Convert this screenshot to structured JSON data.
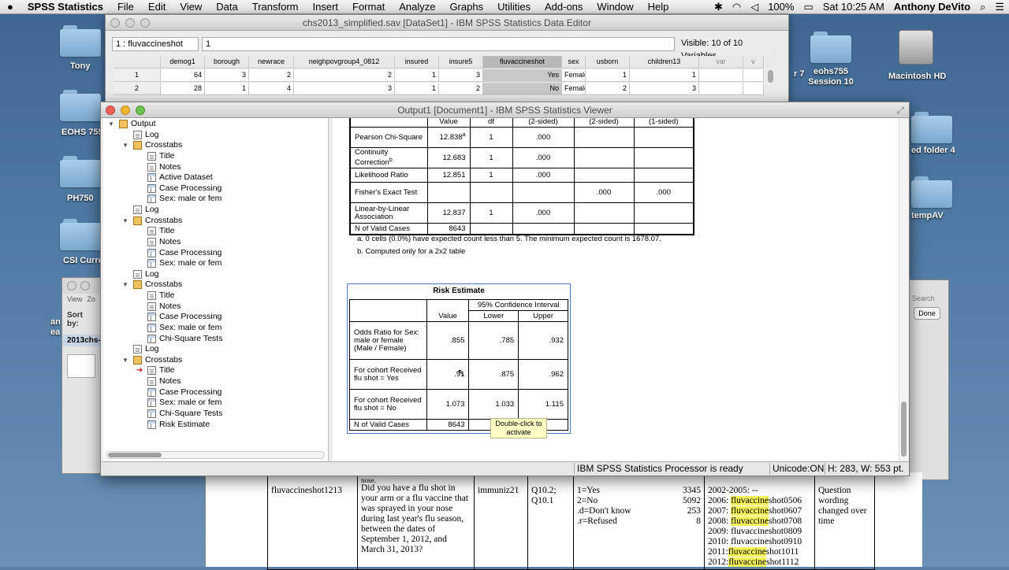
{
  "menubar": {
    "app": "SPSS Statistics",
    "items": [
      "File",
      "Edit",
      "View",
      "Data",
      "Transform",
      "Insert",
      "Format",
      "Analyze",
      "Graphs",
      "Utilities",
      "Add-ons",
      "Window",
      "Help"
    ],
    "battery": "100%",
    "clock": "Sat 10:25 AM",
    "user": "Anthony DeVito"
  },
  "desktop": {
    "left_icons": [
      "Tony",
      "EOHS 755",
      "PH750",
      "CSI Curre"
    ],
    "right_icons": [
      "eohs755 Session 10",
      "Macintosh HD",
      "ed folder 4",
      "tempAV"
    ],
    "partial": "r 7",
    "side_texts": [
      "an",
      "ea"
    ]
  },
  "data_editor": {
    "title": "chs2013_simplified.sav [DataSet1] - IBM SPSS Statistics Data Editor",
    "cell_ref": "1 : fluvaccineshot",
    "cell_value": "1",
    "visible": "Visible: 10 of 10 Variables",
    "columns": [
      "demog1",
      "borough",
      "newrace",
      "neighpovgroup4_0812",
      "insured",
      "insure5",
      "fluvaccineshot",
      "sex",
      "usborn",
      "children13",
      "var",
      "v"
    ],
    "rows": [
      [
        "1",
        "64",
        "3",
        "2",
        "2",
        "1",
        "3",
        "Yes",
        "Female",
        "1",
        "1",
        "",
        ""
      ],
      [
        "2",
        "28",
        "1",
        "4",
        "3",
        "1",
        "2",
        "No",
        "Female",
        "2",
        "3",
        "",
        ""
      ]
    ]
  },
  "viewer": {
    "title": "Output1 [Document1] - IBM SPSS Statistics Viewer",
    "tree": [
      {
        "label": "Output",
        "level": 0,
        "icon": "book",
        "tri": "▼"
      },
      {
        "label": "Log",
        "level": 1,
        "icon": "page"
      },
      {
        "label": "Crosstabs",
        "level": 1,
        "icon": "book",
        "tri": "▼"
      },
      {
        "label": "Title",
        "level": 2,
        "icon": "page"
      },
      {
        "label": "Notes",
        "level": 2,
        "icon": "page"
      },
      {
        "label": "Active Dataset",
        "level": 2,
        "icon": "tbl"
      },
      {
        "label": "Case Processing",
        "level": 2,
        "icon": "tbl"
      },
      {
        "label": "Sex: male or fem",
        "level": 2,
        "icon": "tbl"
      },
      {
        "label": "Log",
        "level": 1,
        "icon": "page"
      },
      {
        "label": "Crosstabs",
        "level": 1,
        "icon": "book",
        "tri": "▼"
      },
      {
        "label": "Title",
        "level": 2,
        "icon": "page"
      },
      {
        "label": "Notes",
        "level": 2,
        "icon": "page"
      },
      {
        "label": "Case Processing",
        "level": 2,
        "icon": "tbl"
      },
      {
        "label": "Sex: male or fem",
        "level": 2,
        "icon": "tbl"
      },
      {
        "label": "Log",
        "level": 1,
        "icon": "page"
      },
      {
        "label": "Crosstabs",
        "level": 1,
        "icon": "book",
        "tri": "▼"
      },
      {
        "label": "Title",
        "level": 2,
        "icon": "page"
      },
      {
        "label": "Notes",
        "level": 2,
        "icon": "page"
      },
      {
        "label": "Case Processing",
        "level": 2,
        "icon": "tbl"
      },
      {
        "label": "Sex: male or fem",
        "level": 2,
        "icon": "tbl"
      },
      {
        "label": "Chi-Square Tests",
        "level": 2,
        "icon": "tbl"
      },
      {
        "label": "Log",
        "level": 1,
        "icon": "page"
      },
      {
        "label": "Crosstabs",
        "level": 1,
        "icon": "book",
        "tri": "▼"
      },
      {
        "label": "Title",
        "level": 2,
        "icon": "page",
        "current": true
      },
      {
        "label": "Notes",
        "level": 2,
        "icon": "page"
      },
      {
        "label": "Case Processing",
        "level": 2,
        "icon": "tbl"
      },
      {
        "label": "Sex: male or fem",
        "level": 2,
        "icon": "tbl"
      },
      {
        "label": "Chi-Square Tests",
        "level": 2,
        "icon": "tbl"
      },
      {
        "label": "Risk Estimate",
        "level": 2,
        "icon": "tbl"
      }
    ],
    "chi": {
      "header": [
        "",
        "Value",
        "df",
        "(2-sided)",
        "(2-sided)",
        "(1-sided)"
      ],
      "rows": [
        {
          "label": "Pearson Chi-Square",
          "value": "12.838",
          "sup": "a",
          "df": "1",
          "p2": ".000",
          "e2": "",
          "e1": ""
        },
        {
          "label": "Continuity Correction",
          "sup_label": "b",
          "value": "12.683",
          "df": "1",
          "p2": ".000",
          "e2": "",
          "e1": ""
        },
        {
          "label": "Likelihood Ratio",
          "value": "12.851",
          "df": "1",
          "p2": ".000",
          "e2": "",
          "e1": ""
        },
        {
          "label": "Fisher's Exact Test",
          "value": "",
          "df": "",
          "p2": "",
          "e2": ".000",
          "e1": ".000"
        },
        {
          "label": "Linear-by-Linear Association",
          "value": "12.837",
          "df": "1",
          "p2": ".000",
          "e2": "",
          "e1": ""
        },
        {
          "label": "N of Valid Cases",
          "value": "8643",
          "df": "",
          "p2": "",
          "e2": "",
          "e1": ""
        }
      ],
      "note_a": "a. 0 cells (0.0%) have expected count less than 5. The minimum expected count is 1678.07.",
      "note_b": "b. Computed only for a 2x2 table"
    },
    "risk": {
      "title": "Risk Estimate",
      "ci_header": "95% Confidence Interval",
      "col_value": "Value",
      "col_lower": "Lower",
      "col_upper": "Upper",
      "rows": [
        {
          "label": "Odds Ratio for Sex: male or female (Male / Female)",
          "value": ".855",
          "lower": ".785",
          "upper": ".932"
        },
        {
          "label": "For cohort Received flu shot = Yes",
          "value": ".91",
          "lower": ".875",
          "upper": ".962"
        },
        {
          "label": "For cohort Received flu shot = No",
          "value": "1.073",
          "lower": "1.033",
          "upper": "1.115"
        },
        {
          "label": "N of Valid Cases",
          "value": "8643",
          "lower": "",
          "upper": ""
        }
      ]
    },
    "tooltip": "Double-click to activate",
    "status": {
      "processor": "IBM SPSS Statistics Processor is ready",
      "unicode": "Unicode:ON",
      "size": "H: 283, W: 553 pt."
    }
  },
  "document": {
    "top_fragment": "nose.",
    "var": "fluvaccineshot1213",
    "question": "Did you have a flu shot in your arm or a flu vaccine that was sprayed in your nose during last year's flu season, between the dates of September 1, 2012, and March 31, 2013?",
    "source": "immuniz21",
    "qnum": "Q10.2; Q10.1",
    "codes": [
      {
        "label": "1=Yes",
        "n": "3345"
      },
      {
        "label": "2=No",
        "n": "5092"
      },
      {
        "label": ".d=Don't know",
        "n": "253"
      },
      {
        "label": ".r=Refused",
        "n": "8"
      }
    ],
    "history": [
      {
        "pre": "2002-2005: --",
        "hl": "",
        "post": ""
      },
      {
        "pre": "2006: ",
        "hl": "fluvaccine",
        "post": "shot0506"
      },
      {
        "pre": "2007: ",
        "hl": "fluvaccine",
        "post": "shot0607"
      },
      {
        "pre": "2008: ",
        "hl": "fluvaccine",
        "post": "shot0708"
      },
      {
        "pre": "2009: fluvaccineshot0809",
        "hl": "",
        "post": ""
      },
      {
        "pre": "2010: fluvaccineshot0910",
        "hl": "",
        "post": ""
      },
      {
        "pre": "2011:",
        "hl": "fluvaccine",
        "post": "shot1011"
      },
      {
        "pre": "2012:",
        "hl": "fluvaccine",
        "post": "shot1112"
      }
    ],
    "note": "Question wording changed over time"
  },
  "finder": {
    "view": "View",
    "zo": "Zo",
    "sort": "Sort by:",
    "file": "2013chs-",
    "search": "Search",
    "done": "Done"
  }
}
